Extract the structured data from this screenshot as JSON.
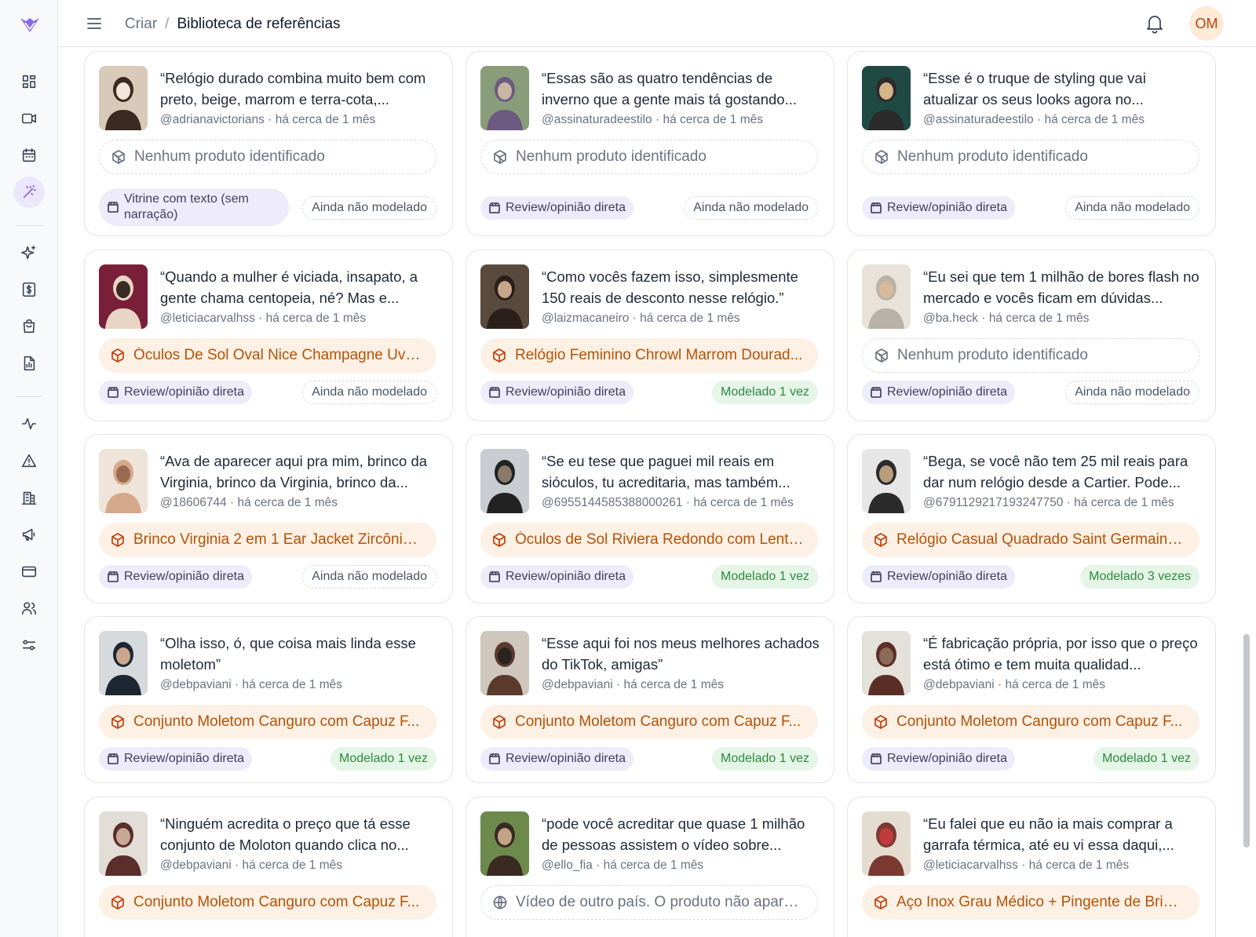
{
  "header": {
    "breadcrumb_parent": "Criar",
    "breadcrumb_sep": "/",
    "breadcrumb_current": "Biblioteca de referências",
    "avatar_initials": "OM"
  },
  "sidebar": {
    "icons": [
      "grid-icon",
      "video-icon",
      "calendar-icon",
      "magic-wand-icon",
      "sparkles-icon",
      "dollar-icon",
      "shopping-bag-icon",
      "report-icon",
      "activity-icon",
      "warning-icon",
      "building-icon",
      "megaphone-icon",
      "credit-card-icon",
      "users-icon",
      "settings-sliders-icon"
    ],
    "active": "magic-wand-icon"
  },
  "colors": {
    "accent": "#7c5cd6",
    "product_found_bg": "#fdf0e4",
    "product_found_text": "#b45309",
    "modeled_bg": "#e5f5e7",
    "modeled_text": "#2f8a3e",
    "format_bg": "#eeebfb"
  },
  "cards": [
    {
      "quote": "“Relógio durado combina muito bem com preto, beige, marrom e terra-cota,...",
      "handle": "@adrianavictorians",
      "time": "há cerca de 1 mês",
      "product": "Nenhum produto identificado",
      "product_found": false,
      "format": "Vitrine com texto (sem narração)",
      "status": "Ainda não modelado",
      "modeled": false
    },
    {
      "quote": "“Essas são as quatro tendências de inverno que a gente mais tá gostando...",
      "handle": "@assinaturadeestilo",
      "time": "há cerca de 1 mês",
      "product": "Nenhum produto identificado",
      "product_found": false,
      "format": "Review/opinião direta",
      "status": "Ainda não modelado",
      "modeled": false
    },
    {
      "quote": "“Esse é o truque de styling que vai atualizar os seus looks agora no...",
      "handle": "@assinaturadeestilo",
      "time": "há cerca de 1 mês",
      "product": "Nenhum produto identificado",
      "product_found": false,
      "format": "Review/opinião direta",
      "status": "Ainda não modelado",
      "modeled": false
    },
    {
      "quote": "“Quando a mulher é viciada, insapato, a gente chama centopeia, né? Mas e...",
      "handle": "@leticiacarvalhss",
      "time": "há cerca de 1 mês",
      "product": "Óculos De Sol Oval Nice Champagne Uv4...",
      "product_found": true,
      "format": "Review/opinião direta",
      "status": "Ainda não modelado",
      "modeled": false
    },
    {
      "quote": "“Como vocês fazem isso, simplesmente 150 reais de desconto nesse relógio.”",
      "handle": "@laizmacaneiro",
      "time": "há cerca de 1 mês",
      "product": "Relógio Feminino Chrowl Marrom Dourad...",
      "product_found": true,
      "format": "Review/opinião direta",
      "status": "Modelado 1 vez",
      "modeled": true
    },
    {
      "quote": "“Eu sei que tem 1 milhão de bores flash no mercado e vocês ficam em dúvidas...",
      "handle": "@ba.heck",
      "time": "há cerca de 1 mês",
      "product": "Nenhum produto identificado",
      "product_found": false,
      "format": "Review/opinião direta",
      "status": "Ainda não modelado",
      "modeled": false
    },
    {
      "quote": "“Ava de aparecer aqui pra mim, brinco da Virginia, brinco da Virginia, brinco da...",
      "handle": "@18606744",
      "time": "há cerca de 1 mês",
      "product": "Brinco Virginia 2 em 1 Ear Jacket Zircônia ...",
      "product_found": true,
      "format": "Review/opinião direta",
      "status": "Ainda não modelado",
      "modeled": false
    },
    {
      "quote": "“Se eu tese que paguei mil reais em sióculos, tu acreditaria, mas também...",
      "handle": "@6955144585388000261",
      "time": "há cerca de 1 mês",
      "product": "Óculos de Sol Riviera Redondo com Lente ...",
      "product_found": true,
      "format": "Review/opinião direta",
      "status": "Modelado 1 vez",
      "modeled": true
    },
    {
      "quote": "“Bega, se você não tem 25 mil reais para dar num relógio desde a Cartier. Pode...",
      "handle": "@6791129217193247750",
      "time": "há cerca de 1 mês",
      "product": "Relógio Casual Quadrado Saint Germain S...",
      "product_found": true,
      "format": "Review/opinião direta",
      "status": "Modelado 3 vezes",
      "modeled": true
    },
    {
      "quote": "“Olha isso, ó, que coisa mais linda esse moletom”",
      "handle": "@debpaviani",
      "time": "há cerca de 1 mês",
      "product": "Conjunto Moletom Canguro com Capuz F...",
      "product_found": true,
      "format": "Review/opinião direta",
      "status": "Modelado 1 vez",
      "modeled": true
    },
    {
      "quote": "“Esse aqui foi nos meus melhores achados do TikTok, amigas”",
      "handle": "@debpaviani",
      "time": "há cerca de 1 mês",
      "product": "Conjunto Moletom Canguro com Capuz F...",
      "product_found": true,
      "format": "Review/opinião direta",
      "status": "Modelado 1 vez",
      "modeled": true
    },
    {
      "quote": "“É fabricação própria, por isso que o preço está ótimo e tem muita qualidad...",
      "handle": "@debpaviani",
      "time": "há cerca de 1 mês",
      "product": "Conjunto Moletom Canguro com Capuz F...",
      "product_found": true,
      "format": "Review/opinião direta",
      "status": "Modelado 1 vez",
      "modeled": true
    },
    {
      "quote": "“Ninguém acredita o preço que tá esse conjunto de Moloton quando clica no...",
      "handle": "@debpaviani",
      "time": "há cerca de 1 mês",
      "product": "Conjunto Moletom Canguro com Capuz F...",
      "product_found": true,
      "format": "",
      "status": "",
      "modeled": false
    },
    {
      "quote": "“pode você acreditar que quase 1 milhão de pessoas assistem o vídeo sobre...",
      "handle": "@ello_fia",
      "time": "há cerca de 1 mês",
      "product": "Vídeo de outro país. O produto não aparec...",
      "product_found": false,
      "product_globe": true,
      "format": "",
      "status": "",
      "modeled": false
    },
    {
      "quote": "“Eu falei que eu não ia mais comprar a garrafa térmica, até eu vi essa daqui,...",
      "handle": "@leticiacarvalhss",
      "time": "há cerca de 1 mês",
      "product": "Aço Inox Grau Médico + Pingente de Brind...",
      "product_found": true,
      "format": "",
      "status": "",
      "modeled": false
    }
  ]
}
